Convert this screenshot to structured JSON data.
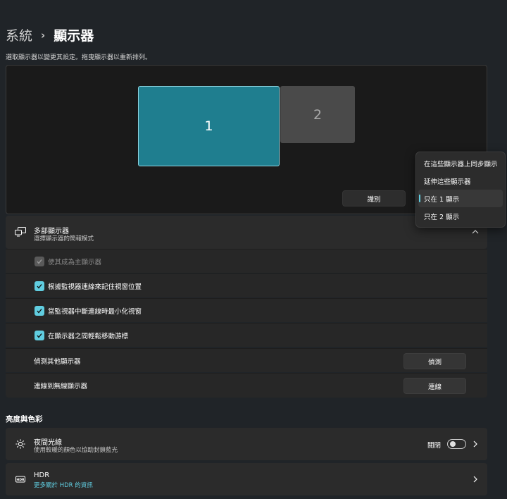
{
  "breadcrumb": {
    "parent": "系統",
    "separator": "›",
    "current": "顯示器"
  },
  "arrange": {
    "hint": "選取顯示器以變更其設定。拖曳顯示器以重新排列。",
    "monitors": [
      {
        "label": "1"
      },
      {
        "label": "2"
      }
    ],
    "identify_label": "識別"
  },
  "multi_display": {
    "title": "多部顯示器",
    "subtitle": "選擇顯示器的簡報模式",
    "options": [
      {
        "label": "使其成為主顯示器",
        "checked": true,
        "disabled": true
      },
      {
        "label": "根據監視器連線來記住視窗位置",
        "checked": true
      },
      {
        "label": "當監視器中斷連線時最小化視窗",
        "checked": true
      },
      {
        "label": "在顯示器之間輕鬆移動游標",
        "checked": true
      }
    ],
    "detect": {
      "label": "偵測其他顯示器",
      "button": "偵測"
    },
    "wireless": {
      "label": "連線到無線顯示器",
      "button": "連線"
    }
  },
  "projection_menu": {
    "items": [
      {
        "label": "在這些顯示器上同步顯示"
      },
      {
        "label": "延伸這些顯示器"
      },
      {
        "label": "只在 1 顯示",
        "selected": true
      },
      {
        "label": "只在 2 顯示"
      }
    ]
  },
  "brightness_section": {
    "title": "亮度與色彩",
    "night_light": {
      "title": "夜間光線",
      "subtitle": "使用較暖的顏色以協助封鎖藍光",
      "state": "關閉",
      "on": false
    },
    "hdr": {
      "title": "HDR",
      "link": "更多關於 HDR 的資訊"
    }
  },
  "colors": {
    "accent": "#60cde0",
    "monitor_selected": "#1f7e8f",
    "background": "#202428"
  }
}
